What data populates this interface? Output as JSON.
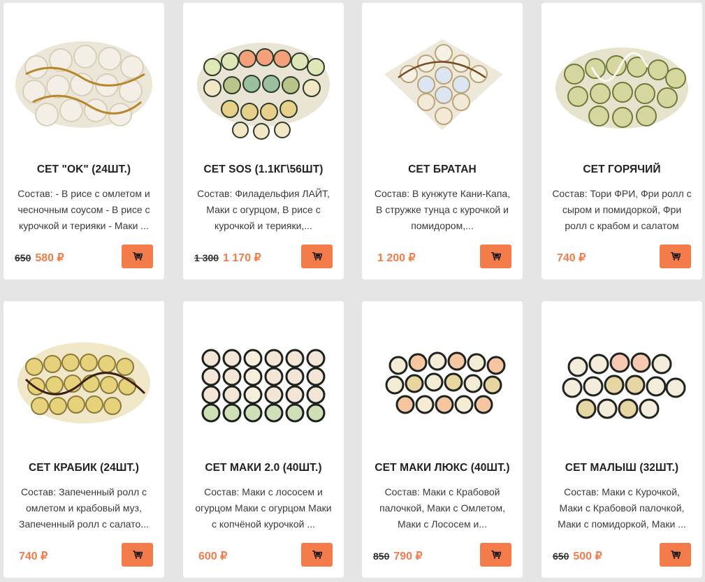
{
  "accent_color": "#f47c4a",
  "products": [
    {
      "title": "СЕТ \"OK\" (24ШТ.)",
      "description": "Состав: - В рисе с омлетом и чесночным соусом - В рисе с курочкой и терияки - Маки ...",
      "old_price": "650",
      "price": "580 ₽",
      "image": "sushi-set-photo"
    },
    {
      "title": "СЕТ SOS (1.1КГ\\56ШТ)",
      "description": "Состав: Филадельфия ЛАЙТ, Маки с огурцом, В рисе с курочкой и терияки,...",
      "old_price": "1 300",
      "price": "1 170 ₽",
      "image": "sushi-set-photo"
    },
    {
      "title": "СЕТ БРАТАН",
      "description": "Состав: В кунжуте Кани-Капа, В стружке тунца с курочкой и помидором,...",
      "old_price": "",
      "price": "1 200 ₽",
      "image": "sushi-set-photo"
    },
    {
      "title": "СЕТ ГОРЯЧИЙ",
      "description": "Состав: Тори ФРИ, Фри ролл с сыром и помидоркой, Фри ролл с крабом и салатом",
      "old_price": "",
      "price": "740 ₽",
      "image": "sushi-set-photo"
    },
    {
      "title": "СЕТ КРАБИК (24ШТ.)",
      "description": "Состав: Запеченный ролл с омлетом и крабовый муз, Запеченный ролл с салато...",
      "old_price": "",
      "price": "740 ₽",
      "image": "sushi-set-photo"
    },
    {
      "title": "СЕТ МАКИ 2.0 (40ШТ.)",
      "description": "Состав: Маки с лососем и огурцом Маки с огурцом Маки с копчёной курочкой ...",
      "old_price": "",
      "price": "600 ₽",
      "image": "sushi-set-photo"
    },
    {
      "title": "СЕТ МАКИ ЛЮКС (40ШТ.)",
      "description": "Состав: Маки с Крабовой палочкой, Маки с Омлетом, Маки с Лососем и...",
      "old_price": "850",
      "price": "790 ₽",
      "image": "sushi-set-photo"
    },
    {
      "title": "СЕТ МАЛЫШ (32ШТ.)",
      "description": "Состав: Маки с Курочкой, Маки с Крабовой палочкой, Маки с помидоркой, Маки ...",
      "old_price": "650",
      "price": "500 ₽",
      "image": "sushi-set-photo"
    }
  ],
  "icons": {
    "cart": "cart-icon"
  }
}
